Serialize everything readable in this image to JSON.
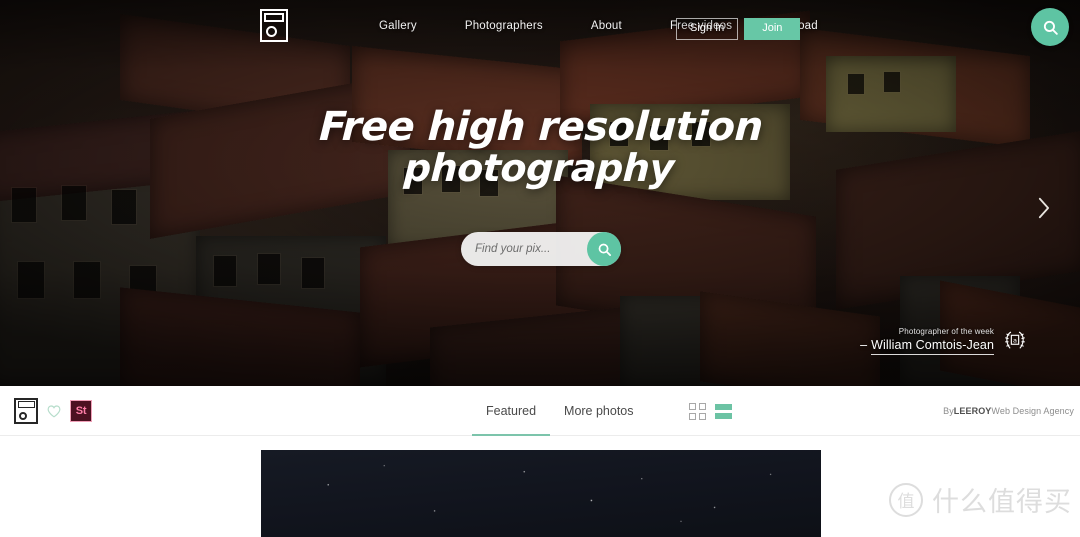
{
  "nav": {
    "logo_icon": "camera-logo-icon",
    "links": [
      {
        "label": "Gallery"
      },
      {
        "label": "Photographers"
      },
      {
        "label": "About"
      },
      {
        "label": "Free videos"
      },
      {
        "label": "Upload"
      }
    ],
    "sign_in_label": "Sign In",
    "join_label": "Join",
    "search_icon": "search-icon"
  },
  "hero": {
    "title_line1": "Free high resolution",
    "title_line2": "photography",
    "search": {
      "placeholder": "Find your pix...",
      "value": "",
      "button_icon": "search-icon"
    },
    "carousel_next_icon": "chevron-right-icon",
    "photographer": {
      "label": "Photographer of the week",
      "name": "William Comtois-Jean",
      "badge_icon": "laurel-wreath-award-icon"
    }
  },
  "tabbar": {
    "brand_icon": "camera-logo-icon",
    "favorite_icon": "heart-icon",
    "stock_badge": "St",
    "tabs": [
      {
        "label": "Featured",
        "active": true
      },
      {
        "label": "More photos",
        "active": false
      }
    ],
    "views": [
      {
        "icon": "grid-view-icon",
        "active": false
      },
      {
        "icon": "list-view-icon",
        "active": true
      }
    ],
    "credit_prefix": "By ",
    "credit_brand": "LEEROY",
    "credit_suffix": " Web Design Agency"
  },
  "watermark": {
    "mark": "值",
    "text": "什么值得买"
  },
  "colors": {
    "accent_green": "#5ec4a3",
    "tab_underline": "#7cc4ab",
    "stock_badge_bg": "#4c1121",
    "stock_badge_fg": "#ff7fa8"
  }
}
